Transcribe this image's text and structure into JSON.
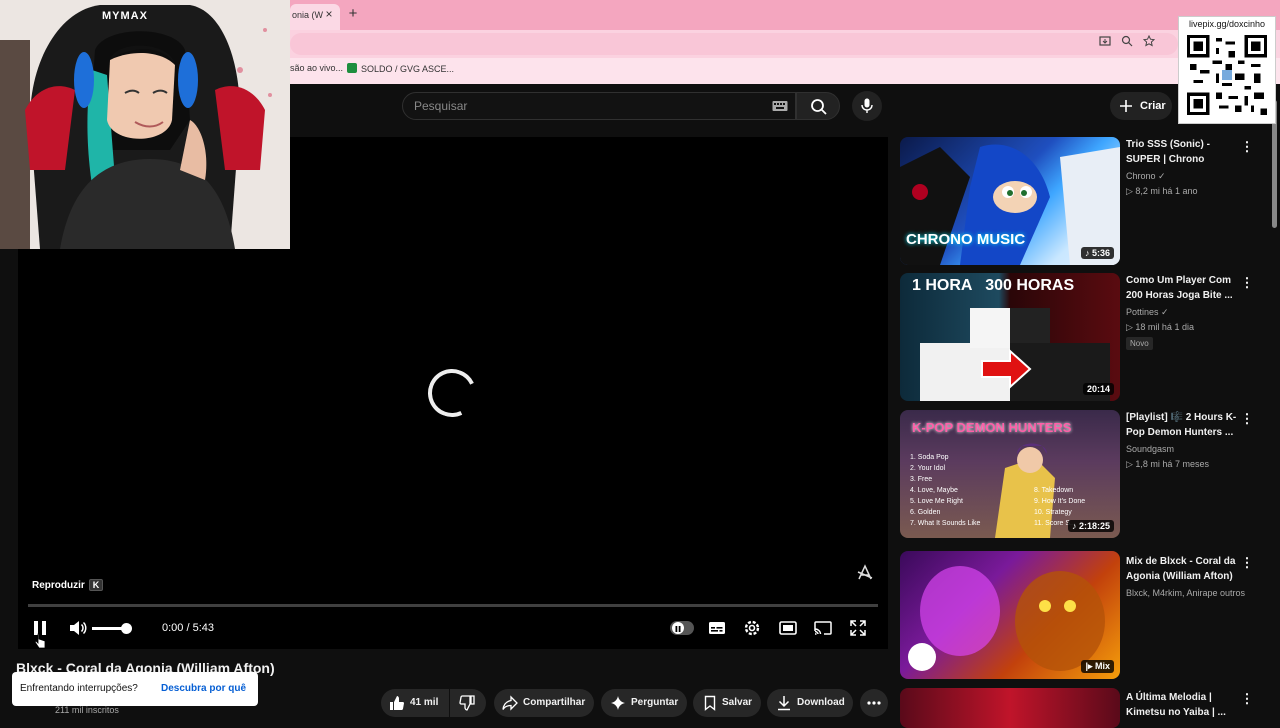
{
  "browser": {
    "tab_title": "onia (W",
    "tab_close": "×",
    "new_tab": "+",
    "bookmarks": [
      "são ao vivo...",
      "SOLDO / GVG ASCE..."
    ]
  },
  "webcam": {
    "brand": "MYMAX"
  },
  "overlay": {
    "qr_caption": "livepix.gg/doxcinho"
  },
  "header": {
    "search_placeholder": "Pesquisar",
    "create_label": "Criar"
  },
  "player": {
    "hint_label": "Reproduzir",
    "hint_key": "K",
    "time": "0:00 / 5:43",
    "progress": 0
  },
  "video": {
    "title": "Blxck - Coral da Agonia (William Afton)",
    "subscribers": "211 mil inscritos",
    "toast_text": "Enfrentando interrupções?",
    "toast_link": "Descubra por quê",
    "actions": {
      "likes": "41 mil",
      "share": "Compartilhar",
      "ask": "Perguntar",
      "save": "Salvar",
      "download": "Download"
    }
  },
  "sidebar": [
    {
      "title": "Trio SSS (Sonic) - SUPER | Chrono",
      "channel": "Chrono ✓",
      "meta": "▷ 8,2 mi   há 1 ano",
      "duration": "♪ 5:36",
      "thumb_text": "CHRONO MUSIC"
    },
    {
      "title": "Como Um Player Com 200 Horas Joga Bite ...",
      "channel": "Pottines ✓",
      "meta": "▷ 18 mil   há 1 dia",
      "badge": "Novo",
      "duration": "20:14",
      "thumb_text": "1 HORA   300 HORAS"
    },
    {
      "title": "[Playlist] 🎼 2 Hours K-Pop Demon Hunters ...",
      "channel": "Soundgasm",
      "meta": "▷ 1,8 mi   há 7 meses",
      "duration": "♪ 2:18:25",
      "thumb_text": "K-POP DEMON HUNTERS",
      "tracklist_left": [
        "1. Soda Pop",
        "2. Your Idol",
        "3. Free",
        "4. Love, Maybe",
        "5. Love Me Right",
        "6. Golden",
        "7. What It Sounds Like"
      ],
      "tracklist_right": [
        "8. Takedown",
        "9. How It's Done",
        "10. Strategy",
        "11. Score S..."
      ]
    },
    {
      "title": "Mix de Blxck - Coral da Agonia (William Afton)",
      "channel": "Blxck, M4rkim, Anirape outros",
      "duration": "|▸ Mix"
    },
    {
      "title": "A Última Melodia | Kimetsu no Yaiba | ..."
    }
  ]
}
